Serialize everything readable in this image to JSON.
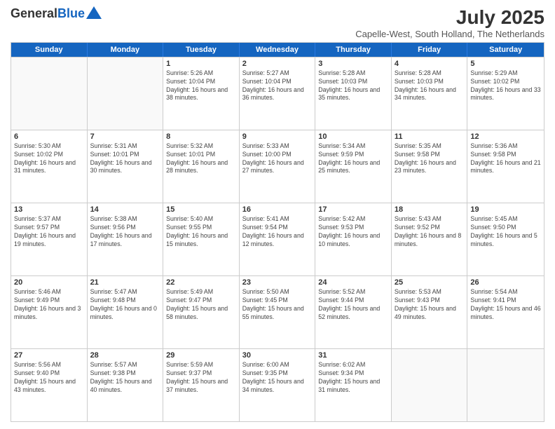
{
  "header": {
    "logo_general": "General",
    "logo_blue": "Blue",
    "month_title": "July 2025",
    "location": "Capelle-West, South Holland, The Netherlands"
  },
  "calendar": {
    "days_of_week": [
      "Sunday",
      "Monday",
      "Tuesday",
      "Wednesday",
      "Thursday",
      "Friday",
      "Saturday"
    ],
    "weeks": [
      [
        {
          "day": "",
          "empty": true
        },
        {
          "day": "",
          "empty": true
        },
        {
          "day": "1",
          "sunrise": "5:26 AM",
          "sunset": "10:04 PM",
          "daylight": "16 hours and 38 minutes."
        },
        {
          "day": "2",
          "sunrise": "5:27 AM",
          "sunset": "10:04 PM",
          "daylight": "16 hours and 36 minutes."
        },
        {
          "day": "3",
          "sunrise": "5:28 AM",
          "sunset": "10:03 PM",
          "daylight": "16 hours and 35 minutes."
        },
        {
          "day": "4",
          "sunrise": "5:28 AM",
          "sunset": "10:03 PM",
          "daylight": "16 hours and 34 minutes."
        },
        {
          "day": "5",
          "sunrise": "5:29 AM",
          "sunset": "10:02 PM",
          "daylight": "16 hours and 33 minutes."
        }
      ],
      [
        {
          "day": "6",
          "sunrise": "5:30 AM",
          "sunset": "10:02 PM",
          "daylight": "16 hours and 31 minutes."
        },
        {
          "day": "7",
          "sunrise": "5:31 AM",
          "sunset": "10:01 PM",
          "daylight": "16 hours and 30 minutes."
        },
        {
          "day": "8",
          "sunrise": "5:32 AM",
          "sunset": "10:01 PM",
          "daylight": "16 hours and 28 minutes."
        },
        {
          "day": "9",
          "sunrise": "5:33 AM",
          "sunset": "10:00 PM",
          "daylight": "16 hours and 27 minutes."
        },
        {
          "day": "10",
          "sunrise": "5:34 AM",
          "sunset": "9:59 PM",
          "daylight": "16 hours and 25 minutes."
        },
        {
          "day": "11",
          "sunrise": "5:35 AM",
          "sunset": "9:58 PM",
          "daylight": "16 hours and 23 minutes."
        },
        {
          "day": "12",
          "sunrise": "5:36 AM",
          "sunset": "9:58 PM",
          "daylight": "16 hours and 21 minutes."
        }
      ],
      [
        {
          "day": "13",
          "sunrise": "5:37 AM",
          "sunset": "9:57 PM",
          "daylight": "16 hours and 19 minutes."
        },
        {
          "day": "14",
          "sunrise": "5:38 AM",
          "sunset": "9:56 PM",
          "daylight": "16 hours and 17 minutes."
        },
        {
          "day": "15",
          "sunrise": "5:40 AM",
          "sunset": "9:55 PM",
          "daylight": "16 hours and 15 minutes."
        },
        {
          "day": "16",
          "sunrise": "5:41 AM",
          "sunset": "9:54 PM",
          "daylight": "16 hours and 12 minutes."
        },
        {
          "day": "17",
          "sunrise": "5:42 AM",
          "sunset": "9:53 PM",
          "daylight": "16 hours and 10 minutes."
        },
        {
          "day": "18",
          "sunrise": "5:43 AM",
          "sunset": "9:52 PM",
          "daylight": "16 hours and 8 minutes."
        },
        {
          "day": "19",
          "sunrise": "5:45 AM",
          "sunset": "9:50 PM",
          "daylight": "16 hours and 5 minutes."
        }
      ],
      [
        {
          "day": "20",
          "sunrise": "5:46 AM",
          "sunset": "9:49 PM",
          "daylight": "16 hours and 3 minutes."
        },
        {
          "day": "21",
          "sunrise": "5:47 AM",
          "sunset": "9:48 PM",
          "daylight": "16 hours and 0 minutes."
        },
        {
          "day": "22",
          "sunrise": "5:49 AM",
          "sunset": "9:47 PM",
          "daylight": "15 hours and 58 minutes."
        },
        {
          "day": "23",
          "sunrise": "5:50 AM",
          "sunset": "9:45 PM",
          "daylight": "15 hours and 55 minutes."
        },
        {
          "day": "24",
          "sunrise": "5:52 AM",
          "sunset": "9:44 PM",
          "daylight": "15 hours and 52 minutes."
        },
        {
          "day": "25",
          "sunrise": "5:53 AM",
          "sunset": "9:43 PM",
          "daylight": "15 hours and 49 minutes."
        },
        {
          "day": "26",
          "sunrise": "5:54 AM",
          "sunset": "9:41 PM",
          "daylight": "15 hours and 46 minutes."
        }
      ],
      [
        {
          "day": "27",
          "sunrise": "5:56 AM",
          "sunset": "9:40 PM",
          "daylight": "15 hours and 43 minutes."
        },
        {
          "day": "28",
          "sunrise": "5:57 AM",
          "sunset": "9:38 PM",
          "daylight": "15 hours and 40 minutes."
        },
        {
          "day": "29",
          "sunrise": "5:59 AM",
          "sunset": "9:37 PM",
          "daylight": "15 hours and 37 minutes."
        },
        {
          "day": "30",
          "sunrise": "6:00 AM",
          "sunset": "9:35 PM",
          "daylight": "15 hours and 34 minutes."
        },
        {
          "day": "31",
          "sunrise": "6:02 AM",
          "sunset": "9:34 PM",
          "daylight": "15 hours and 31 minutes."
        },
        {
          "day": "",
          "empty": true
        },
        {
          "day": "",
          "empty": true
        }
      ]
    ]
  }
}
